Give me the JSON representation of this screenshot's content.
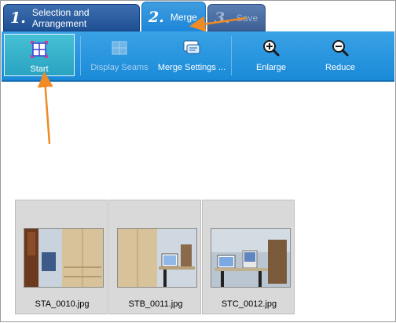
{
  "tabs": [
    {
      "num": "1.",
      "label": "Selection and Arrangement"
    },
    {
      "num": "2.",
      "label": "Merge"
    },
    {
      "num": "3.",
      "label": "Save"
    }
  ],
  "toolbar": {
    "start": "Start",
    "display_seams": "Display Seams",
    "merge_settings": "Merge Settings ...",
    "enlarge": "Enlarge",
    "reduce": "Reduce"
  },
  "thumbnails": [
    {
      "filename": "STA_0010.jpg"
    },
    {
      "filename": "STB_0011.jpg"
    },
    {
      "filename": "STC_0012.jpg"
    }
  ],
  "colors": {
    "toolbar": "#1a8ad8",
    "active_tab": "#1c86d8",
    "arrow": "#f08a24"
  }
}
